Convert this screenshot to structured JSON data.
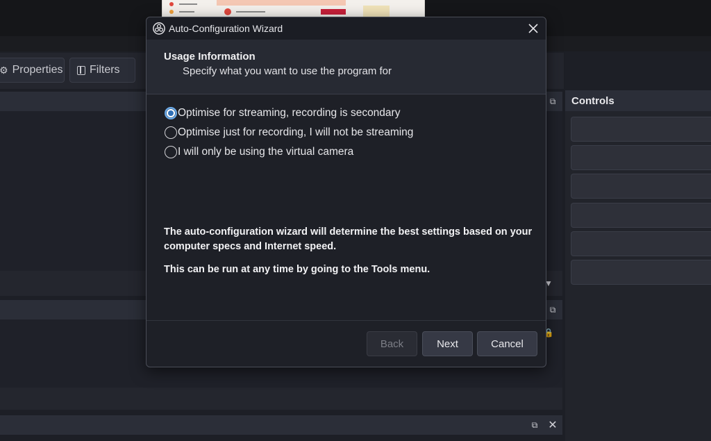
{
  "main_window": {
    "toolbar": {
      "properties_label": "Properties",
      "filters_label": "Filters"
    },
    "controls": {
      "title": "Controls"
    }
  },
  "dialog": {
    "title": "Auto-Configuration Wizard",
    "header": {
      "title": "Usage Information",
      "subtitle": "Specify what you want to use the program for"
    },
    "options": [
      {
        "label": "Optimise for streaming, recording is secondary",
        "selected": true
      },
      {
        "label": "Optimise just for recording, I will not be streaming",
        "selected": false
      },
      {
        "label": "I will only be using the virtual camera",
        "selected": false
      }
    ],
    "info": {
      "line1": "The auto-configuration wizard will determine the best settings based on your computer specs and Internet speed.",
      "line2": "This can be run at any time by going to the Tools menu."
    },
    "buttons": {
      "back": "Back",
      "next": "Next",
      "cancel": "Cancel"
    }
  },
  "colors": {
    "accent": "#2f6fb6",
    "dialog_bg": "#1e2027",
    "header_bg": "#272a33"
  }
}
